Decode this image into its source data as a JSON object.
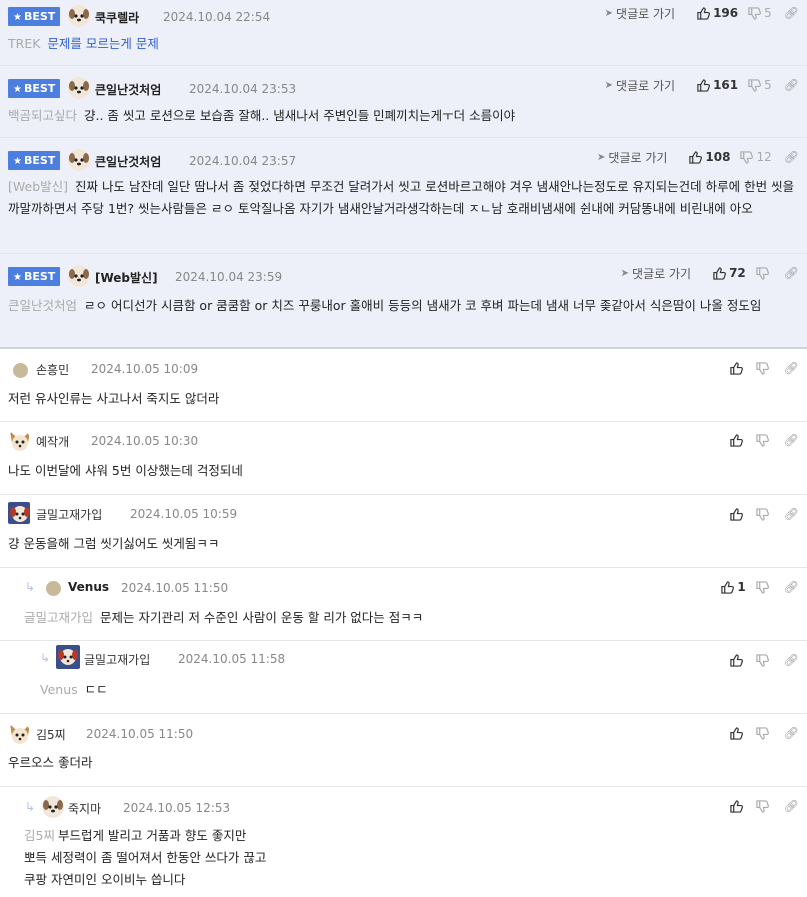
{
  "ui": {
    "best_label": "BEST",
    "reply_link": "댓글로 가기"
  },
  "comments": [
    {
      "best": true,
      "nick": "쿡쿠렐라",
      "date": "2024.10.04 22:54",
      "tag": "TREK",
      "text": "문제를 모르는게 문제",
      "up": "196",
      "down": "5"
    },
    {
      "best": true,
      "nick": "큰일난것처엄",
      "date": "2024.10.04 23:53",
      "tag": "백곰되고싶다",
      "text": "걍.. 좀 씻고 로션으로 보습좀 잘해.. 냄새나서 주변인들 민폐끼치는게ㅜ더 소름이야",
      "up": "161",
      "down": "5"
    },
    {
      "best": true,
      "nick": "큰일난것처엄",
      "date": "2024.10.04 23:57",
      "tag": "[Web발신]",
      "text": "진짜 나도 남잔데 일단 땀나서 좀 젖었다하면 무조건 달려가서 씻고 로션바르고해야 겨우 냄새안나는정도로 유지되는건데 하루에 한번 씻을까말까하면서 주당 1번? 씻는사람들은 ㄹㅇ 토악질나옴 자기가 냄새안날거라생각하는데 ㅈㄴ남 호래비냄새에 쉰내에 커담똥내에 비린내에 아오",
      "up": "108",
      "down": "12"
    },
    {
      "best": true,
      "nick": "[Web발신]",
      "date": "2024.10.04 23:59",
      "tag": "큰일난것처엄",
      "text": "ㄹㅇ 어디선가 시큼함 or 쿰쿰함 or 치즈 꾸룽내or 홀애비 등등의 냄새가 코 후벼 파는데 냄새 너무 좆같아서 식은땀이 나올 정도임",
      "up": "72",
      "down": ""
    },
    {
      "best": false,
      "nick": "손흥민",
      "date": "2024.10.05 10:09",
      "tag": "",
      "text": "저런 유사인류는 사고나서 죽지도 않더라",
      "up": "",
      "down": ""
    },
    {
      "best": false,
      "nick": "예작개",
      "date": "2024.10.05 10:30",
      "tag": "",
      "text": "나도 이번달에 샤워 5번 이상했는데 걱정되네",
      "up": "",
      "down": ""
    },
    {
      "best": false,
      "nick": "글밀고재가입",
      "date": "2024.10.05 10:59",
      "tag": "",
      "text": "걍 운동을해 그럼 씻기싫어도 씻게됨ㅋㅋ",
      "up": "",
      "down": ""
    },
    {
      "best": false,
      "nick": "Venus",
      "date": "2024.10.05 11:50",
      "tag": "글밀고재가입",
      "text": "문제는 자기관리 저 수준인 사람이 운동 할 리가 없다는 점ㅋㅋ",
      "up": "1",
      "down": ""
    },
    {
      "best": false,
      "nick": "글밀고재가입",
      "date": "2024.10.05 11:58",
      "tag": "Venus",
      "text": "ㄷㄷ",
      "up": "",
      "down": ""
    },
    {
      "best": false,
      "nick": "김5찌",
      "date": "2024.10.05 11:50",
      "tag": "",
      "text": "우르오스 좋더라",
      "up": "",
      "down": ""
    },
    {
      "best": false,
      "nick": "죽지마",
      "date": "2024.10.05 12:53",
      "tag": "김5찌",
      "text": "부드럽게 발리고 거품과 향도 좋지만",
      "text2": "뽀득 세정력이 좀 떨어져서 한동안 쓰다가 끊고",
      "text3": "쿠팡 자연미인 오이비누 씁니다",
      "up": "",
      "down": ""
    }
  ]
}
